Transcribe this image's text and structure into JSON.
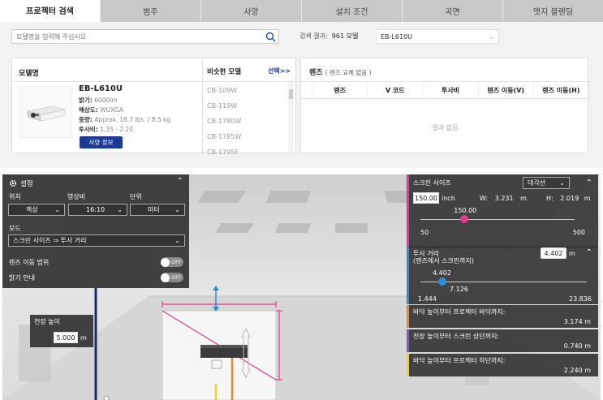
{
  "tabs": [
    "프로젝터 검색",
    "범주",
    "사양",
    "설치 조건",
    "곡면",
    "엣지 블렌딩"
  ],
  "search": {
    "placeholder": "모델명을 입력해 주십시오",
    "result_label": "검색 결과:",
    "result_count": "961 모델",
    "selected_model": "EB-L610U"
  },
  "model": {
    "header": "모델명",
    "name": "EB-L610U",
    "specs": [
      {
        "label": "밝기:",
        "value": "6000lm"
      },
      {
        "label": "해상도:",
        "value": "WUXGA"
      },
      {
        "label": "중량:",
        "value": "Approx. 18.7 lbs. / 8.5 kg"
      },
      {
        "label": "투사비:",
        "value": "1.35 - 2.20"
      }
    ],
    "spec_button": "사양 정보"
  },
  "similar": {
    "header": "비슷한 모델",
    "select_link": "선택>>",
    "items": [
      "CB-109W",
      "CB-119W",
      "CB-1780W",
      "CB-1785W",
      "CB-1795F"
    ]
  },
  "lens": {
    "title": "렌즈",
    "subtitle": "( 렌즈 교체 없음 )",
    "columns": [
      "렌즈",
      "V 코드",
      "투사비",
      "렌즈 이동(V)",
      "렌즈 이동(H)"
    ],
    "empty": "결과 없음"
  },
  "settings": {
    "title": "설정",
    "position_label": "위치",
    "position_value": "책상",
    "aspect_label": "영상비",
    "aspect_value": "16:10",
    "unit_label": "단위",
    "unit_value": "미터",
    "mode_label": "모드",
    "mode_value": "스크린 사이즈 ⇒ 투사 거리",
    "lens_shift_label": "렌즈 이동 범위",
    "lens_shift_state": "OFF",
    "brightness_label": "밝기 안내",
    "brightness_state": "OFF"
  },
  "ceiling": {
    "label": "천장 높이",
    "value": "5.000",
    "unit": "m"
  },
  "screen_size": {
    "label": "스크린 사이즈",
    "type": "대각선",
    "value": "150.00",
    "unit": "inch",
    "w_label": "W:",
    "w_value": "3.231",
    "h_label": "H:",
    "h_value": "2.019",
    "length_unit": "m",
    "slider_value": "150.00",
    "min": "50",
    "max": "500",
    "fraction": 0.2857
  },
  "throw": {
    "label": "투사 거리",
    "sublabel": "(렌즈에서 스크린까지)",
    "value": "4.402",
    "unit": "m",
    "knob_label_top": "4.402",
    "knob_label_bottom": "7.126",
    "min": "1.444",
    "max": "23.836",
    "fraction": 0.132
  },
  "floor_to_bottom": {
    "label": "바닥 높이부터 프로젝터 바닥까지:",
    "value": "3.174 m"
  },
  "ceiling_to_top": {
    "label": "천장 높이부터 스크린 상단까지:",
    "value": "0.740 m"
  },
  "floor_to_proj_bottom": {
    "label": "바닥 높이부터 프로젝터 하단까지:",
    "value": "2.240 m"
  },
  "colors": {
    "accent_blue": "#1b3a94",
    "pink": "#e23a8f",
    "blue": "#2a8fd6",
    "purple": "#7a5bd1",
    "yellow": "#f2d21b"
  }
}
